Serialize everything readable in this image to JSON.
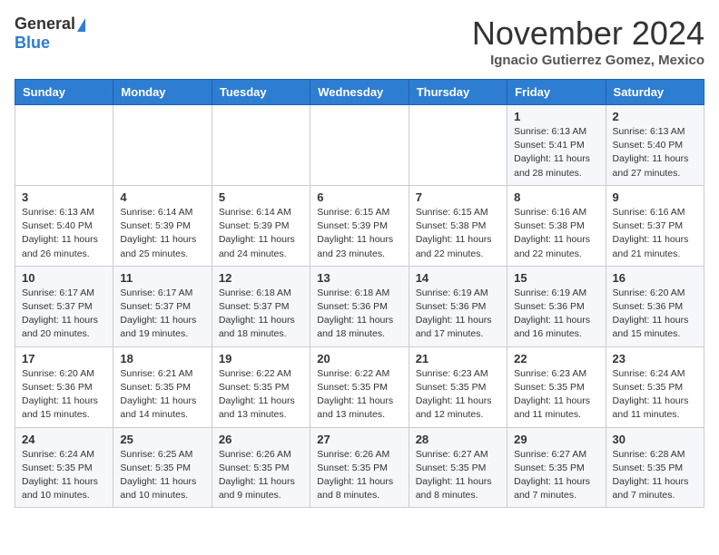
{
  "header": {
    "logo_general": "General",
    "logo_blue": "Blue",
    "month_title": "November 2024",
    "location": "Ignacio Gutierrez Gomez, Mexico"
  },
  "weekdays": [
    "Sunday",
    "Monday",
    "Tuesday",
    "Wednesday",
    "Thursday",
    "Friday",
    "Saturday"
  ],
  "weeks": [
    [
      {
        "day": "",
        "info": ""
      },
      {
        "day": "",
        "info": ""
      },
      {
        "day": "",
        "info": ""
      },
      {
        "day": "",
        "info": ""
      },
      {
        "day": "",
        "info": ""
      },
      {
        "day": "1",
        "info": "Sunrise: 6:13 AM\nSunset: 5:41 PM\nDaylight: 11 hours\nand 28 minutes."
      },
      {
        "day": "2",
        "info": "Sunrise: 6:13 AM\nSunset: 5:40 PM\nDaylight: 11 hours\nand 27 minutes."
      }
    ],
    [
      {
        "day": "3",
        "info": "Sunrise: 6:13 AM\nSunset: 5:40 PM\nDaylight: 11 hours\nand 26 minutes."
      },
      {
        "day": "4",
        "info": "Sunrise: 6:14 AM\nSunset: 5:39 PM\nDaylight: 11 hours\nand 25 minutes."
      },
      {
        "day": "5",
        "info": "Sunrise: 6:14 AM\nSunset: 5:39 PM\nDaylight: 11 hours\nand 24 minutes."
      },
      {
        "day": "6",
        "info": "Sunrise: 6:15 AM\nSunset: 5:39 PM\nDaylight: 11 hours\nand 23 minutes."
      },
      {
        "day": "7",
        "info": "Sunrise: 6:15 AM\nSunset: 5:38 PM\nDaylight: 11 hours\nand 22 minutes."
      },
      {
        "day": "8",
        "info": "Sunrise: 6:16 AM\nSunset: 5:38 PM\nDaylight: 11 hours\nand 22 minutes."
      },
      {
        "day": "9",
        "info": "Sunrise: 6:16 AM\nSunset: 5:37 PM\nDaylight: 11 hours\nand 21 minutes."
      }
    ],
    [
      {
        "day": "10",
        "info": "Sunrise: 6:17 AM\nSunset: 5:37 PM\nDaylight: 11 hours\nand 20 minutes."
      },
      {
        "day": "11",
        "info": "Sunrise: 6:17 AM\nSunset: 5:37 PM\nDaylight: 11 hours\nand 19 minutes."
      },
      {
        "day": "12",
        "info": "Sunrise: 6:18 AM\nSunset: 5:37 PM\nDaylight: 11 hours\nand 18 minutes."
      },
      {
        "day": "13",
        "info": "Sunrise: 6:18 AM\nSunset: 5:36 PM\nDaylight: 11 hours\nand 18 minutes."
      },
      {
        "day": "14",
        "info": "Sunrise: 6:19 AM\nSunset: 5:36 PM\nDaylight: 11 hours\nand 17 minutes."
      },
      {
        "day": "15",
        "info": "Sunrise: 6:19 AM\nSunset: 5:36 PM\nDaylight: 11 hours\nand 16 minutes."
      },
      {
        "day": "16",
        "info": "Sunrise: 6:20 AM\nSunset: 5:36 PM\nDaylight: 11 hours\nand 15 minutes."
      }
    ],
    [
      {
        "day": "17",
        "info": "Sunrise: 6:20 AM\nSunset: 5:36 PM\nDaylight: 11 hours\nand 15 minutes."
      },
      {
        "day": "18",
        "info": "Sunrise: 6:21 AM\nSunset: 5:35 PM\nDaylight: 11 hours\nand 14 minutes."
      },
      {
        "day": "19",
        "info": "Sunrise: 6:22 AM\nSunset: 5:35 PM\nDaylight: 11 hours\nand 13 minutes."
      },
      {
        "day": "20",
        "info": "Sunrise: 6:22 AM\nSunset: 5:35 PM\nDaylight: 11 hours\nand 13 minutes."
      },
      {
        "day": "21",
        "info": "Sunrise: 6:23 AM\nSunset: 5:35 PM\nDaylight: 11 hours\nand 12 minutes."
      },
      {
        "day": "22",
        "info": "Sunrise: 6:23 AM\nSunset: 5:35 PM\nDaylight: 11 hours\nand 11 minutes."
      },
      {
        "day": "23",
        "info": "Sunrise: 6:24 AM\nSunset: 5:35 PM\nDaylight: 11 hours\nand 11 minutes."
      }
    ],
    [
      {
        "day": "24",
        "info": "Sunrise: 6:24 AM\nSunset: 5:35 PM\nDaylight: 11 hours\nand 10 minutes."
      },
      {
        "day": "25",
        "info": "Sunrise: 6:25 AM\nSunset: 5:35 PM\nDaylight: 11 hours\nand 10 minutes."
      },
      {
        "day": "26",
        "info": "Sunrise: 6:26 AM\nSunset: 5:35 PM\nDaylight: 11 hours\nand 9 minutes."
      },
      {
        "day": "27",
        "info": "Sunrise: 6:26 AM\nSunset: 5:35 PM\nDaylight: 11 hours\nand 8 minutes."
      },
      {
        "day": "28",
        "info": "Sunrise: 6:27 AM\nSunset: 5:35 PM\nDaylight: 11 hours\nand 8 minutes."
      },
      {
        "day": "29",
        "info": "Sunrise: 6:27 AM\nSunset: 5:35 PM\nDaylight: 11 hours\nand 7 minutes."
      },
      {
        "day": "30",
        "info": "Sunrise: 6:28 AM\nSunset: 5:35 PM\nDaylight: 11 hours\nand 7 minutes."
      }
    ]
  ]
}
